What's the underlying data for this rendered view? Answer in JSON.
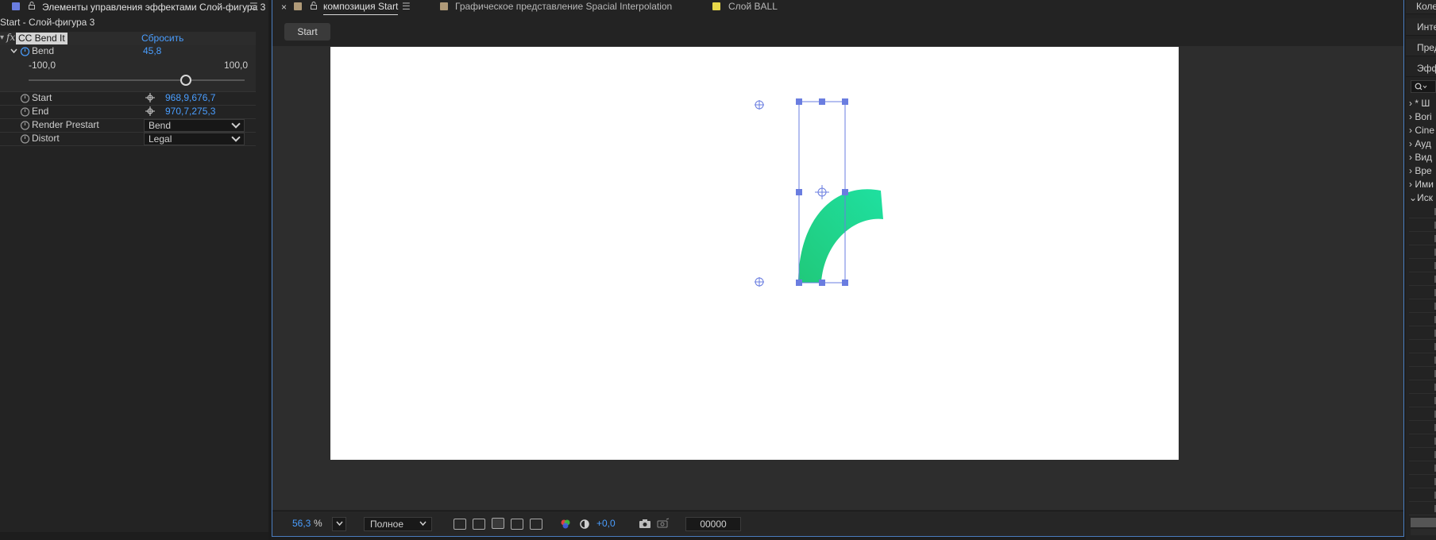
{
  "left_panel": {
    "tab_title": "Элементы управления эффектами Слой-фигура 3",
    "swatch_color": "#6a7de0",
    "layer_path": "Start - Слой-фигура 3",
    "effect": {
      "fx_symbol": "fx",
      "name": "CC Bend It",
      "reset_label": "Сбросить"
    },
    "bend": {
      "label": "Bend",
      "value": "45,8",
      "min_label": "-100,0",
      "max_label": "100,0",
      "slider_min": -100,
      "slider_max": 100,
      "slider_value": 45.8
    },
    "start": {
      "label": "Start",
      "value": "968,9,676,7"
    },
    "end": {
      "label": "End",
      "value": "970,7,275,3"
    },
    "render_prestart": {
      "label": "Render Prestart",
      "value": "Bend"
    },
    "distort": {
      "label": "Distort",
      "value": "Legal"
    }
  },
  "comp_panel": {
    "tabs": [
      {
        "label": "композиция Start",
        "color": "#b09a78",
        "active": true
      },
      {
        "label": "Графическое представление Spacial Interpolation",
        "color": "#b09a78",
        "active": false
      },
      {
        "label": "Слой BALL",
        "color": "#e8d84a",
        "active": false
      }
    ],
    "close_symbol": "×",
    "breadcrumb_button": "Start",
    "shape_gradient": [
      "#20c97a",
      "#1fe0a0"
    ],
    "handle_color": "#6a7de0"
  },
  "bottom_bar": {
    "zoom": "56,3",
    "zoom_unit": "%",
    "resolution": "Полное",
    "exposure": "+0,0",
    "timecode": "00000"
  },
  "right_panel": {
    "rows": [
      "Колеса",
      "Инте",
      "Пред",
      "Эфф"
    ],
    "search_icon": "search-icon",
    "items": [
      "* Ш",
      "Bori",
      "Cine",
      "Ауд",
      "Вид",
      "Вре",
      "Ими",
      "Иск"
    ]
  }
}
